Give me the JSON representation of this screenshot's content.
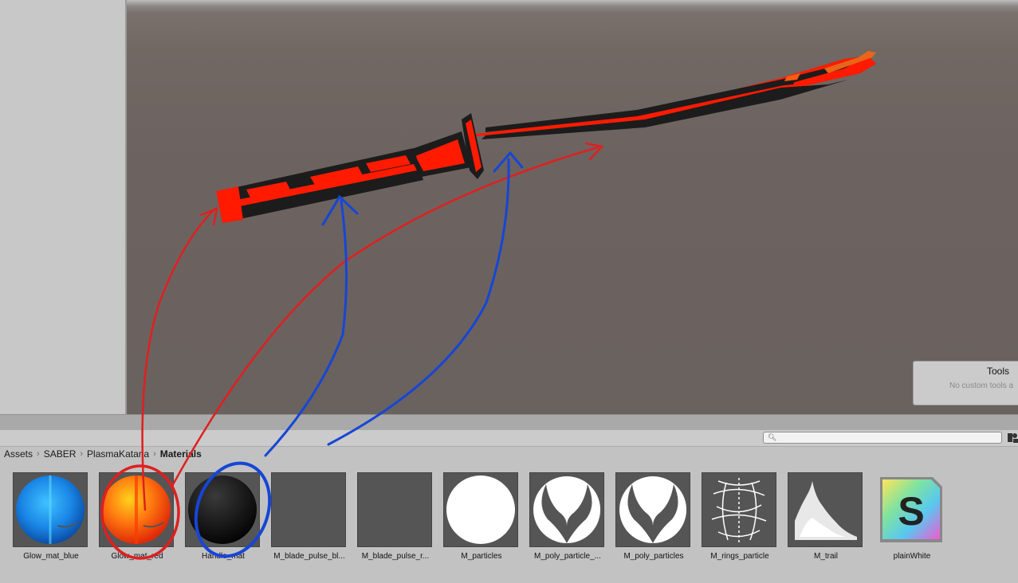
{
  "tools_panel": {
    "title": "Tools",
    "subtitle": "No custom tools a"
  },
  "project": {
    "search": {
      "value": "",
      "placeholder": ""
    },
    "breadcrumb": [
      "Assets",
      "SABER",
      "PlasmaKatana",
      "Materials"
    ],
    "assets": [
      {
        "label": "Glow_mat_blue",
        "icon": "blue-glow-sphere-icon"
      },
      {
        "label": "Glow_mat_red",
        "icon": "red-glow-sphere-icon"
      },
      {
        "label": "Handle_mat",
        "icon": "black-sphere-icon"
      },
      {
        "label": "M_blade_pulse_bl...",
        "icon": "blank-material-icon"
      },
      {
        "label": "M_blade_pulse_r...",
        "icon": "blank-material-icon"
      },
      {
        "label": "M_particles",
        "icon": "white-circle-icon"
      },
      {
        "label": "M_poly_particle_...",
        "icon": "horns-particle-icon"
      },
      {
        "label": "M_poly_particles",
        "icon": "horns-particle-icon"
      },
      {
        "label": "M_rings_particle",
        "icon": "rings-particle-icon"
      },
      {
        "label": "M_trail",
        "icon": "smoke-trail-icon"
      },
      {
        "label": "plainWhite",
        "icon": "shader-graph-icon"
      }
    ]
  },
  "colors": {
    "annotation_red": "#e01f1f",
    "annotation_blue": "#1646d6",
    "blade_red": "#ff1a00",
    "blade_black": "#1c1c1c"
  }
}
